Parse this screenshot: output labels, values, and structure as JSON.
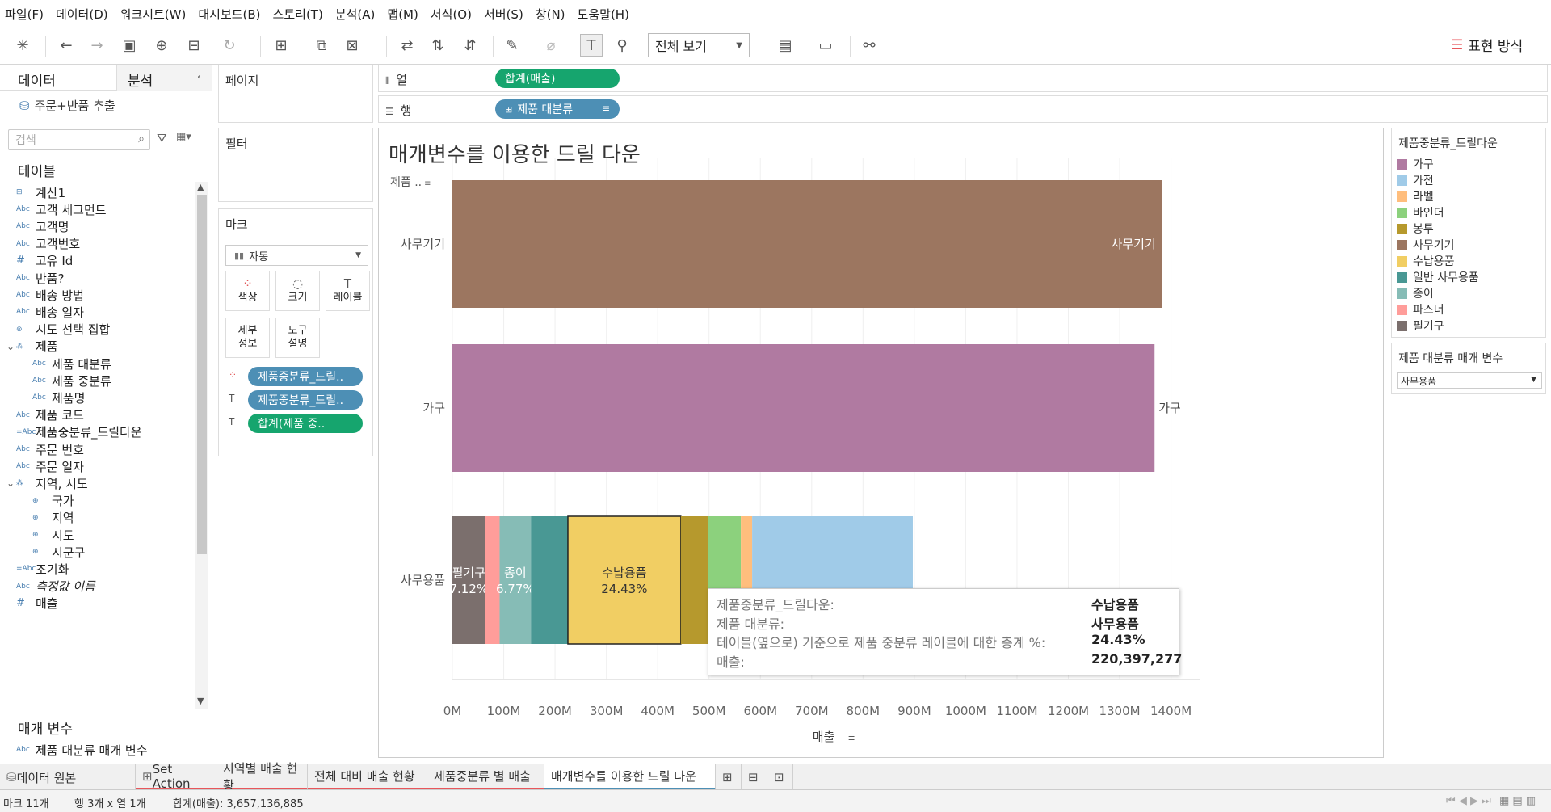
{
  "menu": [
    "파일(F)",
    "데이터(D)",
    "워크시트(W)",
    "대시보드(B)",
    "스토리(T)",
    "분석(A)",
    "맵(M)",
    "서식(O)",
    "서버(S)",
    "창(N)",
    "도움말(H)"
  ],
  "toolbar": {
    "view_mode": "전체 보기",
    "show_me": "표현 방식"
  },
  "left_pane": {
    "tab_data": "데이터",
    "tab_analysis": "분석",
    "datasource": "주문+반품 추출",
    "search_placeholder": "검색",
    "tables_header": "테이블",
    "fields": [
      {
        "icon": "calc",
        "label": "계산1",
        "indent": 0
      },
      {
        "icon": "Abc",
        "label": "고객 세그먼트",
        "indent": 0
      },
      {
        "icon": "Abc",
        "label": "고객명",
        "indent": 0
      },
      {
        "icon": "Abc",
        "label": "고객번호",
        "indent": 0
      },
      {
        "icon": "#",
        "label": "고유 Id",
        "indent": 0
      },
      {
        "icon": "Abc",
        "label": "반품?",
        "indent": 0
      },
      {
        "icon": "Abc",
        "label": "배송 방법",
        "indent": 0
      },
      {
        "icon": "Abc",
        "label": "배송 일자",
        "indent": 0
      },
      {
        "icon": "set",
        "label": "시도 선택 집합",
        "indent": 0
      },
      {
        "icon": "hier",
        "label": "제품",
        "indent": 0,
        "expanded": true
      },
      {
        "icon": "Abc",
        "label": "제품 대분류",
        "indent": 1
      },
      {
        "icon": "Abc",
        "label": "제품 중분류",
        "indent": 1
      },
      {
        "icon": "Abc",
        "label": "제품명",
        "indent": 1
      },
      {
        "icon": "Abc",
        "label": "제품 코드",
        "indent": 0
      },
      {
        "icon": "=Abc",
        "label": "제품중분류_드릴다운",
        "indent": 0
      },
      {
        "icon": "Abc",
        "label": "주문 번호",
        "indent": 0
      },
      {
        "icon": "Abc",
        "label": "주문 일자",
        "indent": 0
      },
      {
        "icon": "hier",
        "label": "지역, 시도",
        "indent": 0,
        "expanded": true
      },
      {
        "icon": "geo",
        "label": "국가",
        "indent": 1
      },
      {
        "icon": "geo",
        "label": "지역",
        "indent": 1
      },
      {
        "icon": "geo",
        "label": "시도",
        "indent": 1
      },
      {
        "icon": "geo",
        "label": "시군구",
        "indent": 1
      },
      {
        "icon": "=Abc",
        "label": "조기화",
        "indent": 0
      },
      {
        "icon": "Abc",
        "label": "측정값 이름",
        "indent": 0,
        "italic": true
      },
      {
        "icon": "#",
        "label": "매출",
        "indent": 0
      }
    ],
    "params_header": "매개 변수",
    "params": [
      {
        "icon": "Abc",
        "label": "제품 대분류 매개 변수"
      }
    ]
  },
  "shelves": {
    "pages": "페이지",
    "filters": "필터",
    "marks": "마크",
    "columns_label": "열",
    "rows_label": "행",
    "columns_pill": "합계(매출)",
    "rows_pill": "제품 대분류"
  },
  "marks_card": {
    "type": "자동",
    "buttons": {
      "color": "색상",
      "size": "크기",
      "label": "레이블",
      "detail": "세부\n정보",
      "tooltip": "도구\n설명"
    },
    "pills": [
      {
        "kind": "color",
        "text": "제품중분류_드릴..",
        "style": "blue"
      },
      {
        "kind": "label",
        "text": "제품중분류_드릴..",
        "style": "blue"
      },
      {
        "kind": "label",
        "text": "합계(제품 중..",
        "style": "green"
      }
    ]
  },
  "view": {
    "title": "매개변수를 이용한 드릴 다운",
    "row_header": "제품 .."
  },
  "chart_data": {
    "type": "bar",
    "orientation": "horizontal",
    "stacked": true,
    "categories": [
      "사무기기",
      "가구",
      "사무용품"
    ],
    "x_axis_label": "매출",
    "x_ticks": [
      "0M",
      "100M",
      "200M",
      "300M",
      "400M",
      "500M",
      "600M",
      "700M",
      "800M",
      "900M",
      "1000M",
      "1100M",
      "1200M",
      "1300M",
      "1400M"
    ],
    "xlim": [
      0,
      1440
    ],
    "segments": [
      {
        "category": "사무기기",
        "subcategory": "사무기기",
        "value": 1383,
        "color": "#9c7660",
        "label": "사무기기"
      },
      {
        "category": "가구",
        "subcategory": "가구",
        "value": 1368,
        "color": "#b07aa1",
        "label": "가구"
      },
      {
        "category": "사무용품",
        "subcategory": "필기구",
        "value": 64,
        "color": "#7b6f6d",
        "label": "필기구",
        "pct": "7.12%"
      },
      {
        "category": "사무용품",
        "subcategory": "파스너",
        "value": 28,
        "color": "#ff9d9a",
        "label": ""
      },
      {
        "category": "사무용품",
        "subcategory": "종이",
        "value": 61,
        "color": "#86bcb6",
        "label": "종이",
        "pct": "6.77%"
      },
      {
        "category": "사무용품",
        "subcategory": "일반 사무용품",
        "value": 72,
        "color": "#499894",
        "label": ""
      },
      {
        "category": "사무용품",
        "subcategory": "수납용품",
        "value": 220,
        "color": "#f1ce63",
        "label": "수납용품",
        "pct": "24.43%"
      },
      {
        "category": "사무용품",
        "subcategory": "봉투",
        "value": 53,
        "color": "#b6992d",
        "label": ""
      },
      {
        "category": "사무용품",
        "subcategory": "바인더",
        "value": 64,
        "color": "#8cd17d",
        "label": ""
      },
      {
        "category": "사무용품",
        "subcategory": "라벨",
        "value": 22,
        "color": "#ffbe7d",
        "label": ""
      },
      {
        "category": "사무용품",
        "subcategory": "가전",
        "value": 313,
        "color": "#a0cbe8",
        "label": ""
      }
    ]
  },
  "legend": {
    "title": "제품중분류_드릴다운",
    "items": [
      {
        "label": "가구",
        "color": "#b07aa1"
      },
      {
        "label": "가전",
        "color": "#a0cbe8"
      },
      {
        "label": "라벨",
        "color": "#ffbe7d"
      },
      {
        "label": "바인더",
        "color": "#8cd17d"
      },
      {
        "label": "봉투",
        "color": "#b6992d"
      },
      {
        "label": "사무기기",
        "color": "#9c7660"
      },
      {
        "label": "수납용품",
        "color": "#f1ce63"
      },
      {
        "label": "일반 사무용품",
        "color": "#499894"
      },
      {
        "label": "종이",
        "color": "#86bcb6"
      },
      {
        "label": "파스너",
        "color": "#ff9d9a"
      },
      {
        "label": "필기구",
        "color": "#7b6f6d"
      }
    ]
  },
  "parameter_card": {
    "title": "제품 대분류 매개 변수",
    "value": "사무용품"
  },
  "tooltip": {
    "rows": [
      {
        "key": "제품중분류_드릴다운:",
        "value": "수납용품"
      },
      {
        "key": "제품 대분류:",
        "value": "사무용품"
      },
      {
        "key": "테이블(옆으로) 기준으로 제품 중분류 레이블에 대한 총계 %:",
        "value": "24.43%"
      },
      {
        "key": "매출:",
        "value": "220,397,277"
      }
    ]
  },
  "bottom_tabs": [
    {
      "label": "데이터 원본",
      "icon": "datasource",
      "active": false
    },
    {
      "label": "Set Action",
      "icon": "dashboard",
      "active": false
    },
    {
      "label": "지역별 매출 현황",
      "active": false
    },
    {
      "label": "전체 대비 매출 현황",
      "active": false
    },
    {
      "label": "제품중분류 별 매출",
      "active": false
    },
    {
      "label": "매개변수를 이용한 드릴 다운",
      "active": true
    }
  ],
  "status": {
    "marks": "마크 11개",
    "rows_cols": "행 3개 x 열 1개",
    "sum": "합계(매출): 3,657,136,885"
  },
  "colors": {
    "accent_green": "#16a56e",
    "accent_blue": "#4d8fb5",
    "tab_underline": "#e8565b"
  }
}
